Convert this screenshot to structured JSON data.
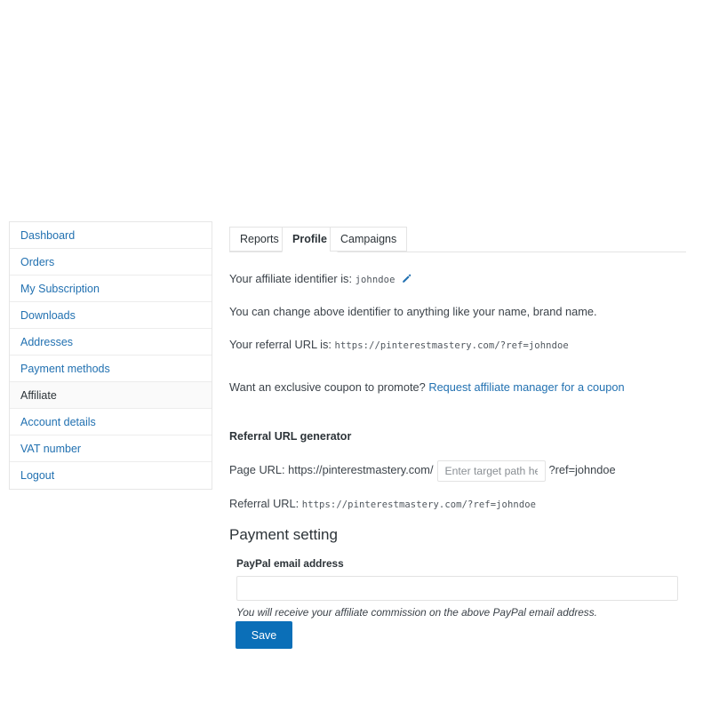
{
  "sidebar": {
    "items": [
      {
        "label": "Dashboard",
        "active": false
      },
      {
        "label": "Orders",
        "active": false
      },
      {
        "label": "My Subscription",
        "active": false
      },
      {
        "label": "Downloads",
        "active": false
      },
      {
        "label": "Addresses",
        "active": false
      },
      {
        "label": "Payment methods",
        "active": false
      },
      {
        "label": "Affiliate",
        "active": true
      },
      {
        "label": "Account details",
        "active": false
      },
      {
        "label": "VAT number",
        "active": false
      },
      {
        "label": "Logout",
        "active": false
      }
    ]
  },
  "tabs": [
    {
      "label": "Reports",
      "active": false
    },
    {
      "label": "Profile",
      "active": true
    },
    {
      "label": "Campaigns",
      "active": false
    }
  ],
  "profile": {
    "identifier_label": "Your affiliate identifier is:",
    "identifier_value": "johndoe",
    "edit_icon": "pencil-icon",
    "change_note": "You can change above identifier to anything like your name, brand name.",
    "referral_url_label": "Your referral URL is:",
    "referral_url_value": "https://pinterestmastery.com/?ref=johndoe",
    "coupon_question": "Want an exclusive coupon to promote?",
    "coupon_link": "Request affiliate manager for a coupon"
  },
  "generator": {
    "heading": "Referral URL generator",
    "page_url_label": "Page URL:",
    "base_url": "https://pinterestmastery.com/",
    "path_placeholder": "Enter target path here.",
    "path_value": "",
    "ref_suffix": "?ref=johndoe",
    "result_label": "Referral URL:",
    "result_value": "https://pinterestmastery.com/?ref=johndoe"
  },
  "payment": {
    "heading": "Payment setting",
    "paypal_label": "PayPal email address",
    "paypal_value": "",
    "paypal_placeholder": "",
    "help_text": "You will receive your affiliate commission on the above PayPal email address.",
    "save_label": "Save"
  },
  "colors": {
    "link": "#2271b1",
    "text": "#3c434a",
    "heading": "#2c3338",
    "button": "#0b6fb8",
    "border": "#e4e4e4",
    "active_row": "#fafafa"
  }
}
